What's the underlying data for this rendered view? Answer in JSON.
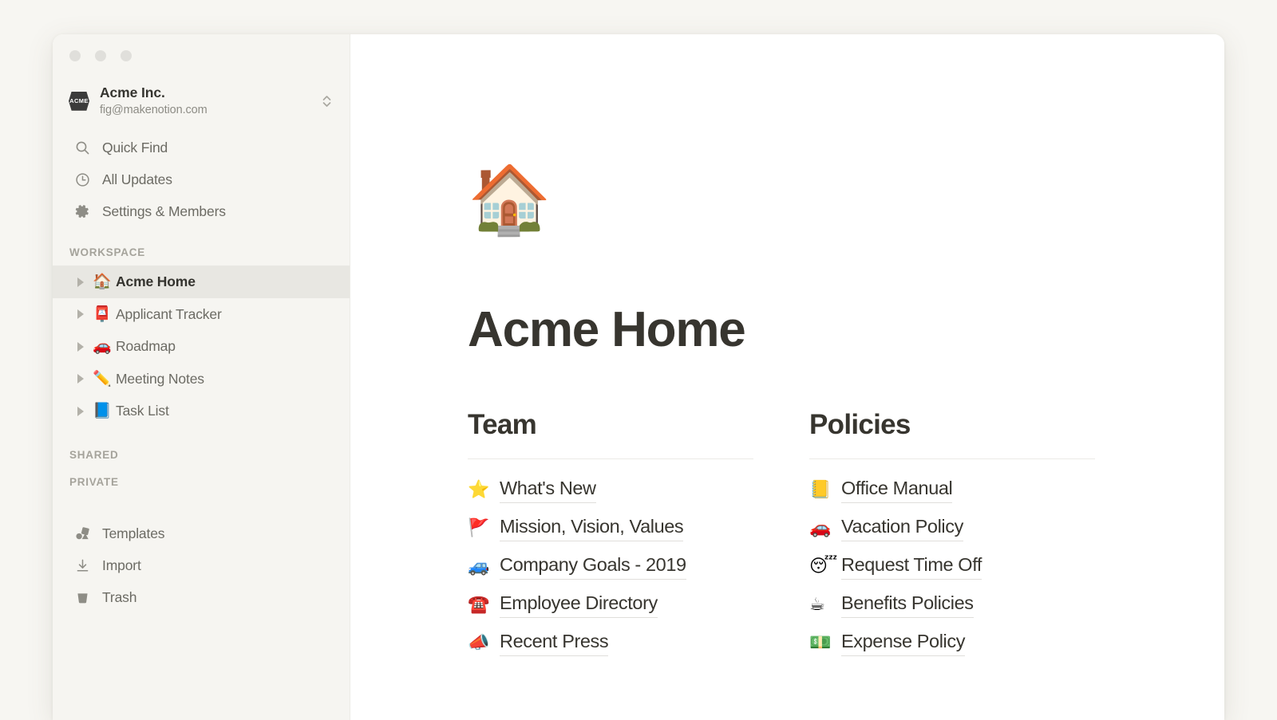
{
  "window": {
    "traffic_lights": [
      "close",
      "minimize",
      "zoom"
    ]
  },
  "sidebar": {
    "workspace_switcher": {
      "logo_text": "ACME",
      "name": "Acme Inc.",
      "email": "fig@makenotion.com",
      "switch_icon": "expand-vertical-icon"
    },
    "nav_items": [
      {
        "icon": "search-icon",
        "label": "Quick Find"
      },
      {
        "icon": "clock-icon",
        "label": "All Updates"
      },
      {
        "icon": "gear-icon",
        "label": "Settings & Members"
      }
    ],
    "sections": {
      "workspace_label": "WORKSPACE",
      "shared_label": "SHARED",
      "private_label": "PRIVATE"
    },
    "workspace_pages": [
      {
        "emoji": "🏠",
        "emoji_name": "house-emoji",
        "label": "Acme Home",
        "selected": true
      },
      {
        "emoji": "📮",
        "emoji_name": "postbox-emoji",
        "label": "Applicant Tracker",
        "selected": false
      },
      {
        "emoji": "🚗",
        "emoji_name": "car-emoji",
        "label": "Roadmap",
        "selected": false
      },
      {
        "emoji": "✏️",
        "emoji_name": "pencil-emoji",
        "label": "Meeting Notes",
        "selected": false
      },
      {
        "emoji": "📘",
        "emoji_name": "blue-book-emoji",
        "label": "Task List",
        "selected": false
      }
    ],
    "bottom_items": [
      {
        "icon": "templates-icon",
        "label": "Templates"
      },
      {
        "icon": "import-icon",
        "label": "Import"
      },
      {
        "icon": "trash-icon",
        "label": "Trash"
      }
    ]
  },
  "main": {
    "page_emoji": "🏠",
    "page_emoji_name": "house-emoji",
    "title": "Acme Home",
    "columns": [
      {
        "heading": "Team",
        "links": [
          {
            "emoji": "⭐",
            "emoji_name": "star-emoji",
            "label": "What's New"
          },
          {
            "emoji": "🚩",
            "emoji_name": "triangular-flag-emoji",
            "label": "Mission, Vision, Values"
          },
          {
            "emoji": "🚙",
            "emoji_name": "suv-emoji",
            "label": "Company Goals - 2019"
          },
          {
            "emoji": "☎️",
            "emoji_name": "telephone-emoji",
            "label": "Employee Directory"
          },
          {
            "emoji": "📣",
            "emoji_name": "megaphone-emoji",
            "label": "Recent Press"
          }
        ]
      },
      {
        "heading": "Policies",
        "links": [
          {
            "emoji": "📒",
            "emoji_name": "ledger-emoji",
            "label": "Office Manual"
          },
          {
            "emoji": "🚗",
            "emoji_name": "car-emoji",
            "label": "Vacation Policy"
          },
          {
            "emoji": "😴",
            "emoji_name": "sleeping-face-emoji",
            "label": "Request Time Off"
          },
          {
            "emoji": "☕",
            "emoji_name": "coffee-emoji",
            "label": "Benefits Policies"
          },
          {
            "emoji": "💵",
            "emoji_name": "dollar-banknote-emoji",
            "label": "Expense Policy"
          }
        ]
      }
    ]
  },
  "colors": {
    "page_background": "#f7f6f2",
    "sidebar_background": "#f6f5f1",
    "selected_row": "#e8e7e2",
    "text_primary": "#37352f",
    "text_secondary": "#6c6b64",
    "text_muted": "#a5a39b",
    "rule": "#eceae6"
  }
}
